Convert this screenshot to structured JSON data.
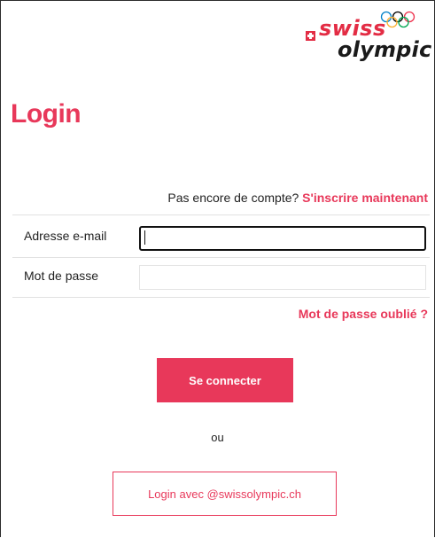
{
  "brand": {
    "logo_line1": "swiss",
    "logo_line2": "olympic",
    "accent_color": "#e8385a",
    "flag_color": "#e32c44"
  },
  "page": {
    "title": "Login"
  },
  "signup": {
    "prompt": "Pas encore de compte?",
    "link_label": "S'inscrire maintenant"
  },
  "form": {
    "email_label": "Adresse e-mail",
    "email_value": "",
    "password_label": "Mot de passe",
    "password_value": "",
    "forgot_label": "Mot de passe oublié ?",
    "submit_label": "Se connecter",
    "or_label": "ou",
    "sso_label": "Login avec @swissolympic.ch"
  }
}
